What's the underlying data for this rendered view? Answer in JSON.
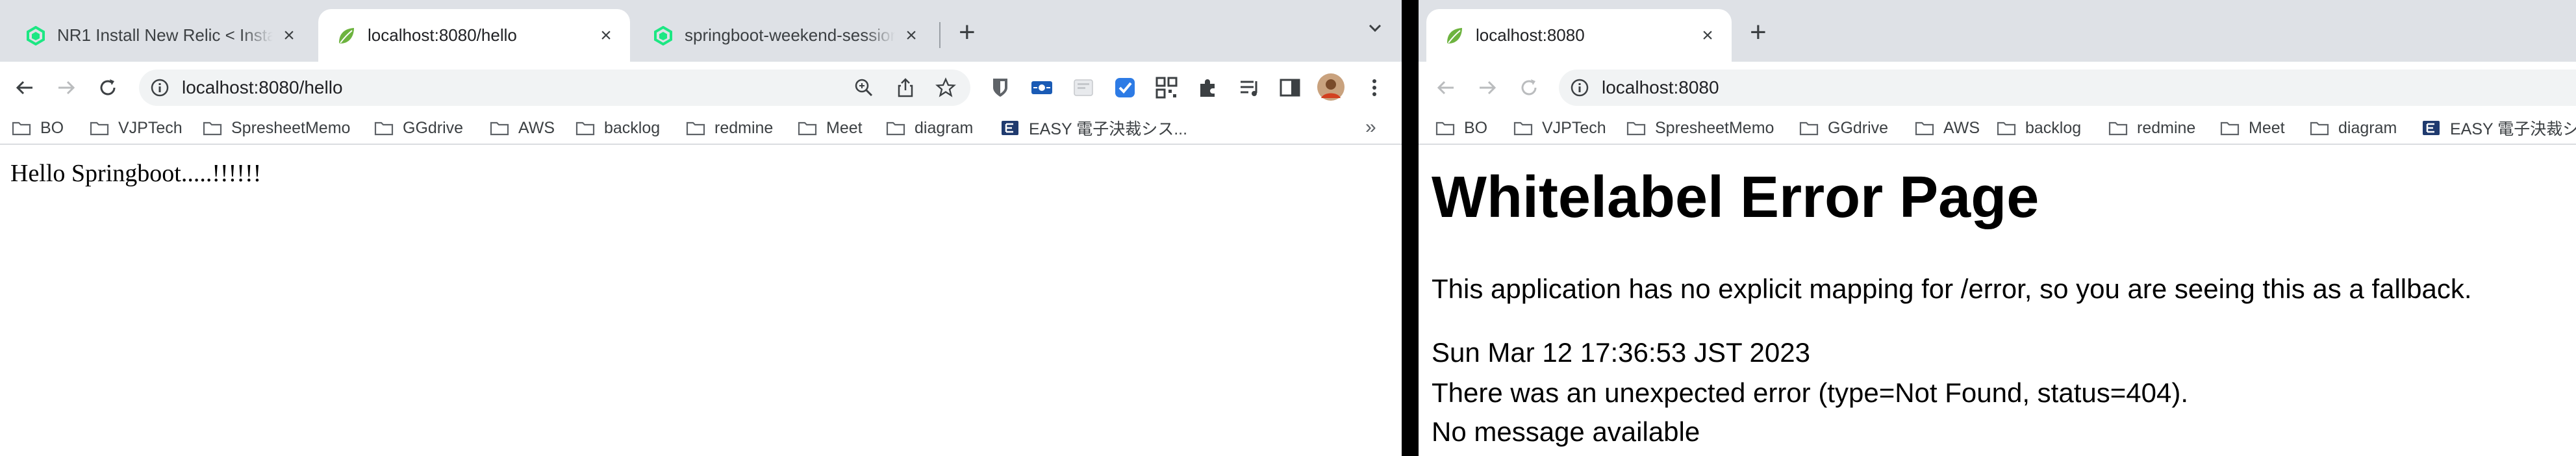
{
  "left_window": {
    "tabs": [
      {
        "title": "NR1 Install New Relic < Installat",
        "favicon": "newrelic-icon",
        "active": false
      },
      {
        "title": "localhost:8080/hello",
        "favicon": "spring-leaf-icon",
        "active": true
      },
      {
        "title": "springboot-weekend-session -",
        "favicon": "newrelic-icon",
        "active": false
      }
    ],
    "new_tab": "+",
    "url": "localhost:8080/hello",
    "page_text": "Hello Springboot.....!!!!!!"
  },
  "right_window": {
    "tabs": [
      {
        "title": "localhost:8080",
        "favicon": "spring-leaf-icon",
        "active": true
      }
    ],
    "new_tab": "+",
    "url": "localhost:8080",
    "error_page": {
      "title": "Whitelabel Error Page",
      "message": "This application has no explicit mapping for /error, so you are seeing this as a fallback.",
      "date": "Sun Mar 12 17:36:53 JST 2023",
      "error_detail": "There was an unexpected error (type=Not Found, status=404).",
      "note": "No message available"
    }
  },
  "bookmarks": [
    "BO",
    "VJPTech",
    "SpresheetMemo",
    "GGdrive",
    "AWS",
    "backlog",
    "redmine",
    "Meet",
    "diagram",
    "EASY 電子決裁シス..."
  ],
  "bookmarks_right_last": "EASY 電子決裁シス",
  "bookmarks_more": "»",
  "tab_close": "×",
  "tab_menu": "⌄",
  "colors": {
    "tabstrip": "#dee1e6",
    "omnibox": "#f1f3f4",
    "spring_green": "#6db33f",
    "newrelic_green": "#1ce783",
    "bitwarden_blue": "#175ddc"
  }
}
